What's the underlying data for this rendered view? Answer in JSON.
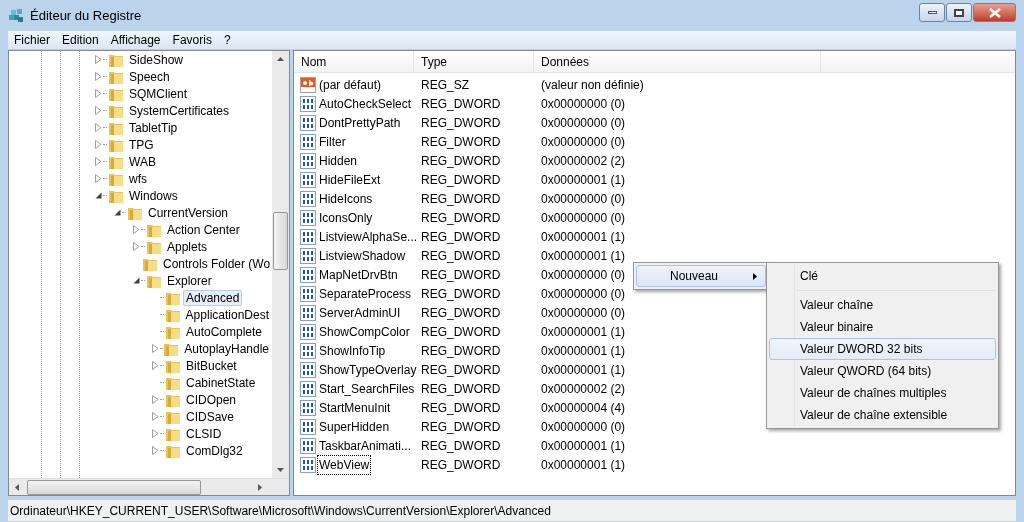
{
  "window": {
    "title": "Éditeur du Registre"
  },
  "menu": [
    "Fichier",
    "Edition",
    "Affichage",
    "Favoris",
    "?"
  ],
  "tree": [
    {
      "label": "SideShow",
      "has_children": true,
      "expanded": false,
      "selected": false
    },
    {
      "label": "Speech",
      "has_children": true,
      "expanded": false,
      "selected": false
    },
    {
      "label": "SQMClient",
      "has_children": true,
      "expanded": false,
      "selected": false
    },
    {
      "label": "SystemCertificates",
      "has_children": true,
      "expanded": false,
      "selected": false
    },
    {
      "label": "TabletTip",
      "has_children": true,
      "expanded": false,
      "selected": false
    },
    {
      "label": "TPG",
      "has_children": true,
      "expanded": false,
      "selected": false
    },
    {
      "label": "WAB",
      "has_children": true,
      "expanded": false,
      "selected": false
    },
    {
      "label": "wfs",
      "has_children": true,
      "expanded": false,
      "selected": false
    },
    {
      "label": "Windows",
      "has_children": true,
      "expanded": true,
      "selected": false,
      "children": [
        {
          "label": "CurrentVersion",
          "has_children": true,
          "expanded": true,
          "selected": false,
          "children": [
            {
              "label": "Action Center",
              "has_children": true,
              "expanded": false,
              "selected": false
            },
            {
              "label": "Applets",
              "has_children": true,
              "expanded": false,
              "selected": false
            },
            {
              "label": "Controls Folder (Wo",
              "has_children": false,
              "selected": false
            },
            {
              "label": "Explorer",
              "has_children": true,
              "expanded": true,
              "selected": false,
              "children": [
                {
                  "label": "Advanced",
                  "has_children": false,
                  "selected": true
                },
                {
                  "label": "ApplicationDest",
                  "has_children": false,
                  "selected": false
                },
                {
                  "label": "AutoComplete",
                  "has_children": false,
                  "selected": false
                },
                {
                  "label": "AutoplayHandle",
                  "has_children": true,
                  "expanded": false,
                  "selected": false
                },
                {
                  "label": "BitBucket",
                  "has_children": true,
                  "expanded": false,
                  "selected": false
                },
                {
                  "label": "CabinetState",
                  "has_children": false,
                  "selected": false
                },
                {
                  "label": "CIDOpen",
                  "has_children": true,
                  "expanded": false,
                  "selected": false
                },
                {
                  "label": "CIDSave",
                  "has_children": true,
                  "expanded": false,
                  "selected": false
                },
                {
                  "label": "CLSID",
                  "has_children": true,
                  "expanded": false,
                  "selected": false
                },
                {
                  "label": "ComDlg32",
                  "has_children": true,
                  "expanded": false,
                  "selected": false
                }
              ]
            }
          ]
        }
      ]
    }
  ],
  "table": {
    "columns": [
      "Nom",
      "Type",
      "Données"
    ],
    "rows": [
      {
        "kind": "string",
        "name": "(par défaut)",
        "type": "REG_SZ",
        "data": "(valeur non définie)",
        "focused": false
      },
      {
        "kind": "dword",
        "name": "AutoCheckSelect",
        "type": "REG_DWORD",
        "data": "0x00000000 (0)",
        "focused": false
      },
      {
        "kind": "dword",
        "name": "DontPrettyPath",
        "type": "REG_DWORD",
        "data": "0x00000000 (0)",
        "focused": false
      },
      {
        "kind": "dword",
        "name": "Filter",
        "type": "REG_DWORD",
        "data": "0x00000000 (0)",
        "focused": false
      },
      {
        "kind": "dword",
        "name": "Hidden",
        "type": "REG_DWORD",
        "data": "0x00000002 (2)",
        "focused": false
      },
      {
        "kind": "dword",
        "name": "HideFileExt",
        "type": "REG_DWORD",
        "data": "0x00000001 (1)",
        "focused": false
      },
      {
        "kind": "dword",
        "name": "HideIcons",
        "type": "REG_DWORD",
        "data": "0x00000000 (0)",
        "focused": false
      },
      {
        "kind": "dword",
        "name": "IconsOnly",
        "type": "REG_DWORD",
        "data": "0x00000000 (0)",
        "focused": false
      },
      {
        "kind": "dword",
        "name": "ListviewAlphaSe...",
        "type": "REG_DWORD",
        "data": "0x00000001 (1)",
        "focused": false
      },
      {
        "kind": "dword",
        "name": "ListviewShadow",
        "type": "REG_DWORD",
        "data": "0x00000001 (1)",
        "focused": false
      },
      {
        "kind": "dword",
        "name": "MapNetDrvBtn",
        "type": "REG_DWORD",
        "data": "0x00000000 (0)",
        "focused": false
      },
      {
        "kind": "dword",
        "name": "SeparateProcess",
        "type": "REG_DWORD",
        "data": "0x00000000 (0)",
        "focused": false
      },
      {
        "kind": "dword",
        "name": "ServerAdminUI",
        "type": "REG_DWORD",
        "data": "0x00000000 (0)",
        "focused": false
      },
      {
        "kind": "dword",
        "name": "ShowCompColor",
        "type": "REG_DWORD",
        "data": "0x00000001 (1)",
        "focused": false
      },
      {
        "kind": "dword",
        "name": "ShowInfoTip",
        "type": "REG_DWORD",
        "data": "0x00000001 (1)",
        "focused": false
      },
      {
        "kind": "dword",
        "name": "ShowTypeOverlay",
        "type": "REG_DWORD",
        "data": "0x00000001 (1)",
        "focused": false
      },
      {
        "kind": "dword",
        "name": "Start_SearchFiles",
        "type": "REG_DWORD",
        "data": "0x00000002 (2)",
        "focused": false
      },
      {
        "kind": "dword",
        "name": "StartMenuInit",
        "type": "REG_DWORD",
        "data": "0x00000004 (4)",
        "focused": false
      },
      {
        "kind": "dword",
        "name": "SuperHidden",
        "type": "REG_DWORD",
        "data": "0x00000000 (0)",
        "focused": false
      },
      {
        "kind": "dword",
        "name": "TaskbarAnimati...",
        "type": "REG_DWORD",
        "data": "0x00000001 (1)",
        "focused": false
      },
      {
        "kind": "dword",
        "name": "WebView",
        "type": "REG_DWORD",
        "data": "0x00000001 (1)",
        "focused": true
      }
    ]
  },
  "context_menu": {
    "label": "Nouveau",
    "submenu": [
      {
        "label": "Clé",
        "separator_after": true,
        "selected": false
      },
      {
        "label": "Valeur chaîne",
        "separator_after": false,
        "selected": false
      },
      {
        "label": "Valeur binaire",
        "separator_after": false,
        "selected": false
      },
      {
        "label": "Valeur DWORD 32 bits",
        "separator_after": false,
        "selected": true
      },
      {
        "label": "Valeur QWORD (64 bits)",
        "separator_after": false,
        "selected": false
      },
      {
        "label": "Valeur de chaînes multiples",
        "separator_after": false,
        "selected": false
      },
      {
        "label": "Valeur de chaîne extensible",
        "separator_after": false,
        "selected": false
      }
    ]
  },
  "status_bar": "Ordinateur\\HKEY_CURRENT_USER\\Software\\Microsoft\\Windows\\CurrentVersion\\Explorer\\Advanced"
}
